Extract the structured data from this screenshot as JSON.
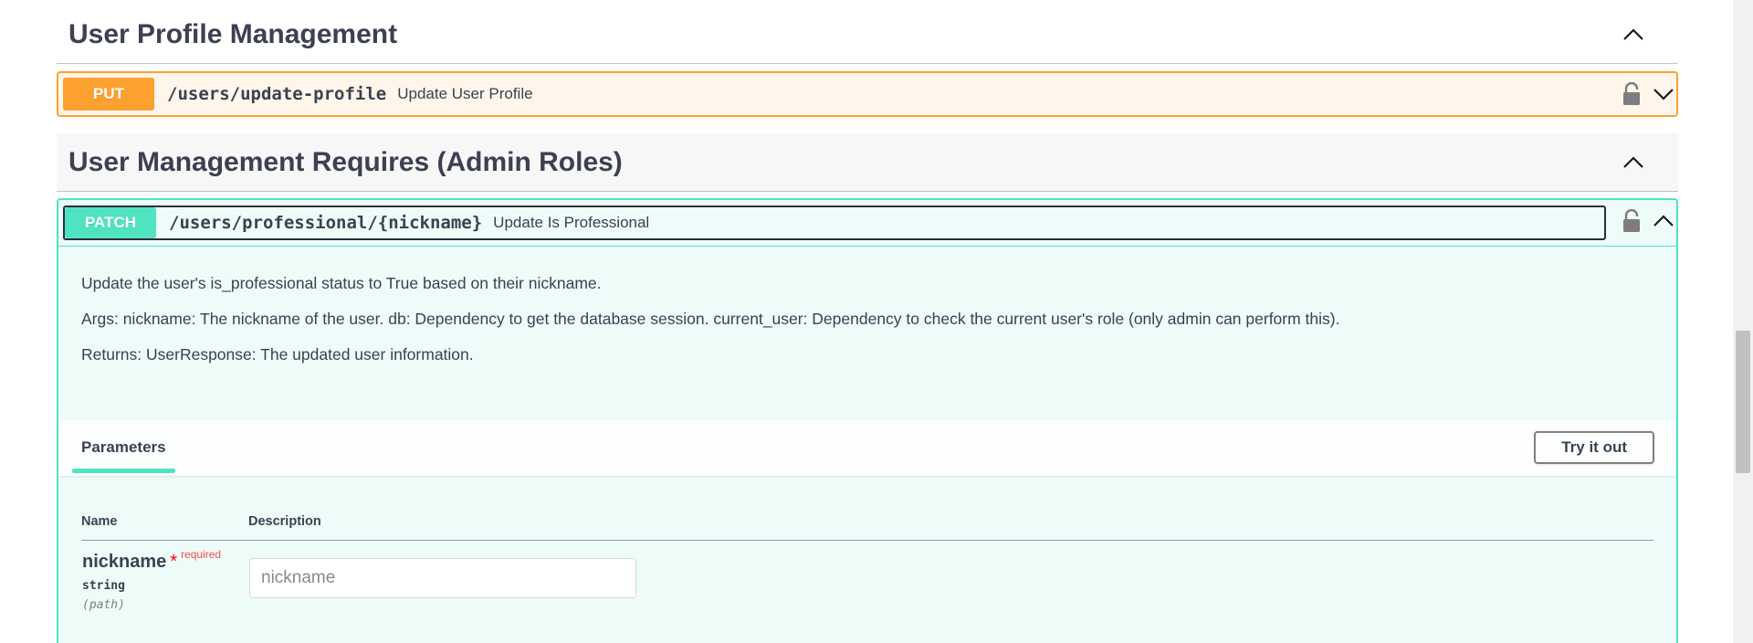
{
  "sections": [
    {
      "title": "User Profile Management",
      "operations": [
        {
          "method": "PUT",
          "path": "/users/update-profile",
          "summary": "Update User Profile",
          "expanded": false
        }
      ]
    },
    {
      "title": "User Management Requires (Admin Roles)",
      "operations": [
        {
          "method": "PATCH",
          "path": "/users/professional/{nickname}",
          "summary": "Update Is Professional",
          "expanded": true,
          "description": [
            "Update the user's is_professional status to True based on their nickname.",
            "Args: nickname: The nickname of the user. db: Dependency to get the database session. current_user: Dependency to check the current user's role (only admin can perform this).",
            "Returns: UserResponse: The updated user information."
          ],
          "parameters_tab": "Parameters",
          "try_it_out_label": "Try it out",
          "table_headers": {
            "name": "Name",
            "description": "Description"
          },
          "parameters": [
            {
              "name": "nickname",
              "required_star": "*",
              "required_label": "required",
              "type": "string",
              "in": "(path)",
              "placeholder": "nickname",
              "value": ""
            }
          ]
        }
      ]
    }
  ],
  "colors": {
    "put": "#fca130",
    "patch": "#50e3c2",
    "required": "#ff0000",
    "text": "#3b4151"
  },
  "icons": {
    "collapse": "chevron-up-icon",
    "expand": "chevron-down-icon",
    "auth": "lock-icon"
  }
}
